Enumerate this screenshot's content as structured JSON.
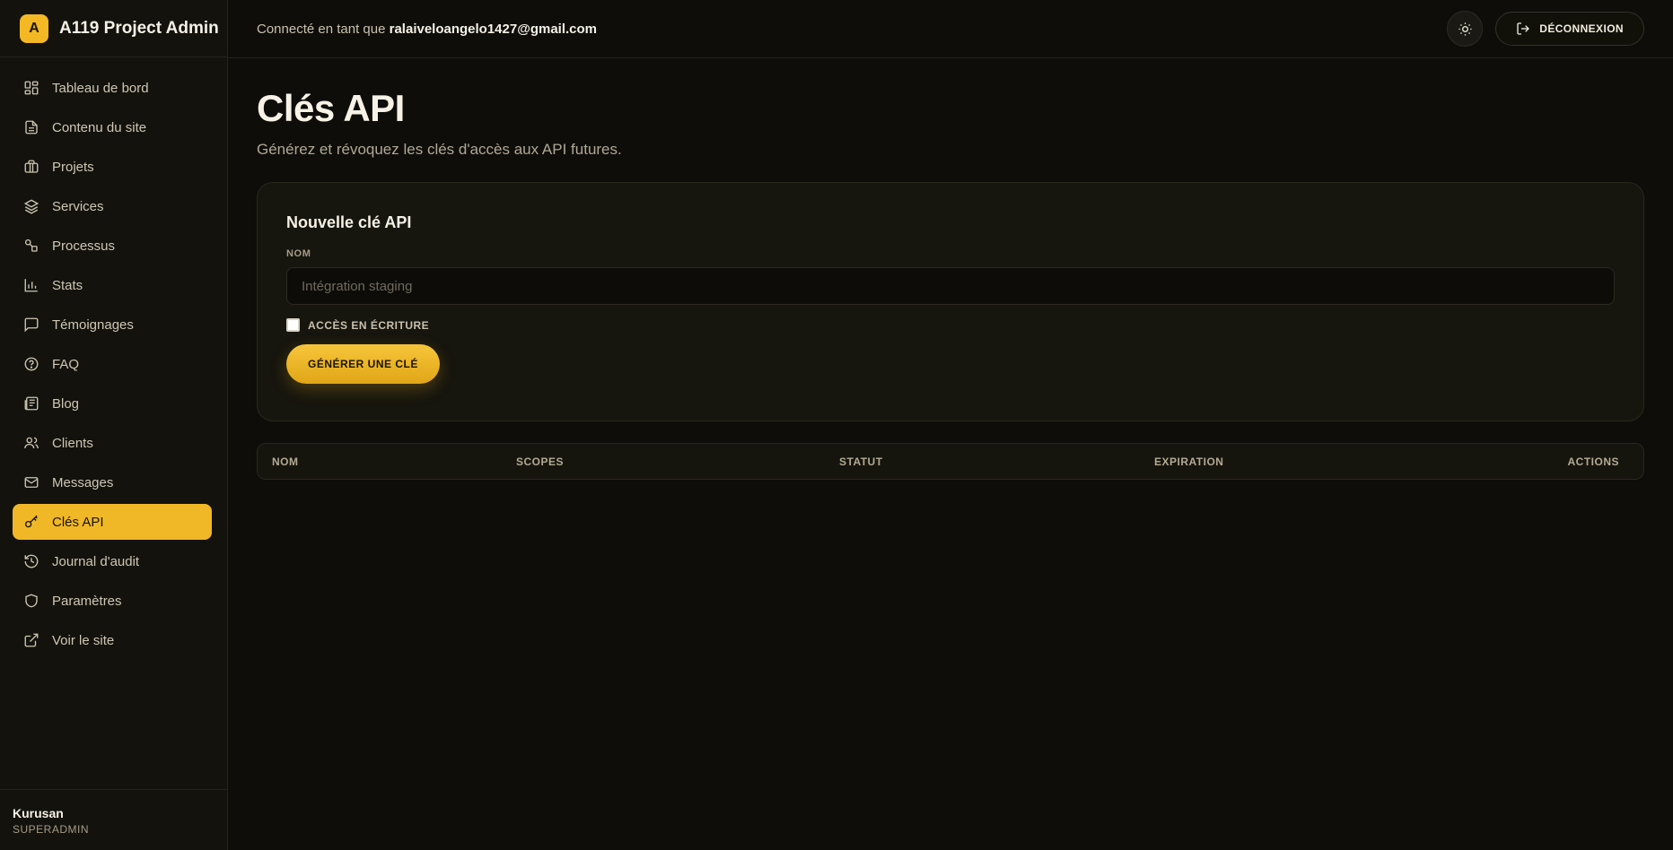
{
  "brand": {
    "logo_letter": "A",
    "title": "A119 Project Admin",
    "accent": "#f3b823"
  },
  "sidebar": {
    "items": [
      {
        "label": "Tableau de bord",
        "icon": "dashboard-icon"
      },
      {
        "label": "Contenu du site",
        "icon": "document-icon"
      },
      {
        "label": "Projets",
        "icon": "briefcase-icon"
      },
      {
        "label": "Services",
        "icon": "layers-icon"
      },
      {
        "label": "Processus",
        "icon": "workflow-icon"
      },
      {
        "label": "Stats",
        "icon": "bar-chart-icon"
      },
      {
        "label": "Témoignages",
        "icon": "message-square-icon"
      },
      {
        "label": "FAQ",
        "icon": "help-circle-icon"
      },
      {
        "label": "Blog",
        "icon": "newspaper-icon"
      },
      {
        "label": "Clients",
        "icon": "users-icon"
      },
      {
        "label": "Messages",
        "icon": "mail-icon"
      },
      {
        "label": "Clés API",
        "icon": "key-icon",
        "active": true
      },
      {
        "label": "Journal d'audit",
        "icon": "history-icon"
      },
      {
        "label": "Paramètres",
        "icon": "shield-icon"
      },
      {
        "label": "Voir le site",
        "icon": "external-link-icon"
      }
    ],
    "user": {
      "name": "Kurusan",
      "role": "SUPERADMIN"
    }
  },
  "topbar": {
    "connected_prefix": "Connecté en tant que",
    "email": "ralaiveloangelo1427@gmail.com",
    "theme_icon": "sun-icon",
    "logout_label": "DÉCONNEXION"
  },
  "main": {
    "title": "Clés API",
    "subtitle": "Générez et révoquez les clés d'accès aux API futures.",
    "form": {
      "title": "Nouvelle clé API",
      "name_label": "NOM",
      "name_placeholder": "Intégration staging",
      "name_value": "",
      "write_access_label": "ACCÈS EN ÉCRITURE",
      "write_access_checked": false,
      "submit_label": "GÉNÉRER UNE CLÉ"
    },
    "table": {
      "columns": [
        "NOM",
        "SCOPES",
        "STATUT",
        "EXPIRATION",
        "ACTIONS"
      ]
    }
  }
}
